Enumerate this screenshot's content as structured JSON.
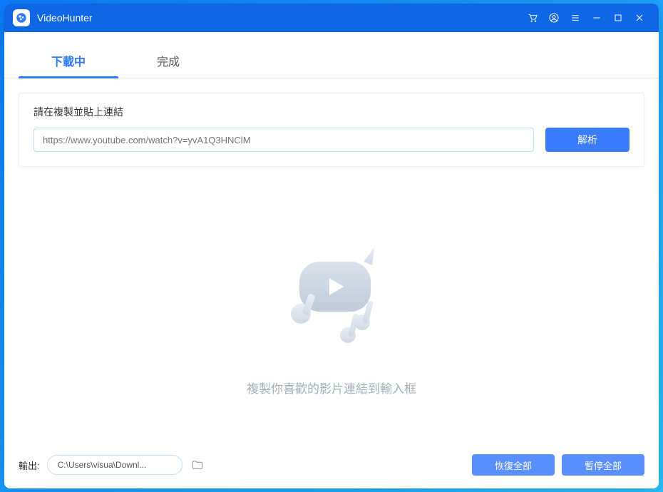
{
  "titlebar": {
    "app_name": "VideoHunter"
  },
  "tabs": {
    "downloading": "下載中",
    "completed": "完成"
  },
  "input_card": {
    "label": "請在複製並貼上連結",
    "placeholder": "https://www.youtube.com/watch?v=yvA1Q3HNClM",
    "parse_btn": "解析"
  },
  "empty_state": {
    "message": "複製你喜歡的影片連結到輸入框"
  },
  "footer": {
    "output_label": "輸出:",
    "output_path": "C:\\Users\\visua\\Downl...",
    "resume_all": "恢復全部",
    "pause_all": "暫停全部"
  }
}
